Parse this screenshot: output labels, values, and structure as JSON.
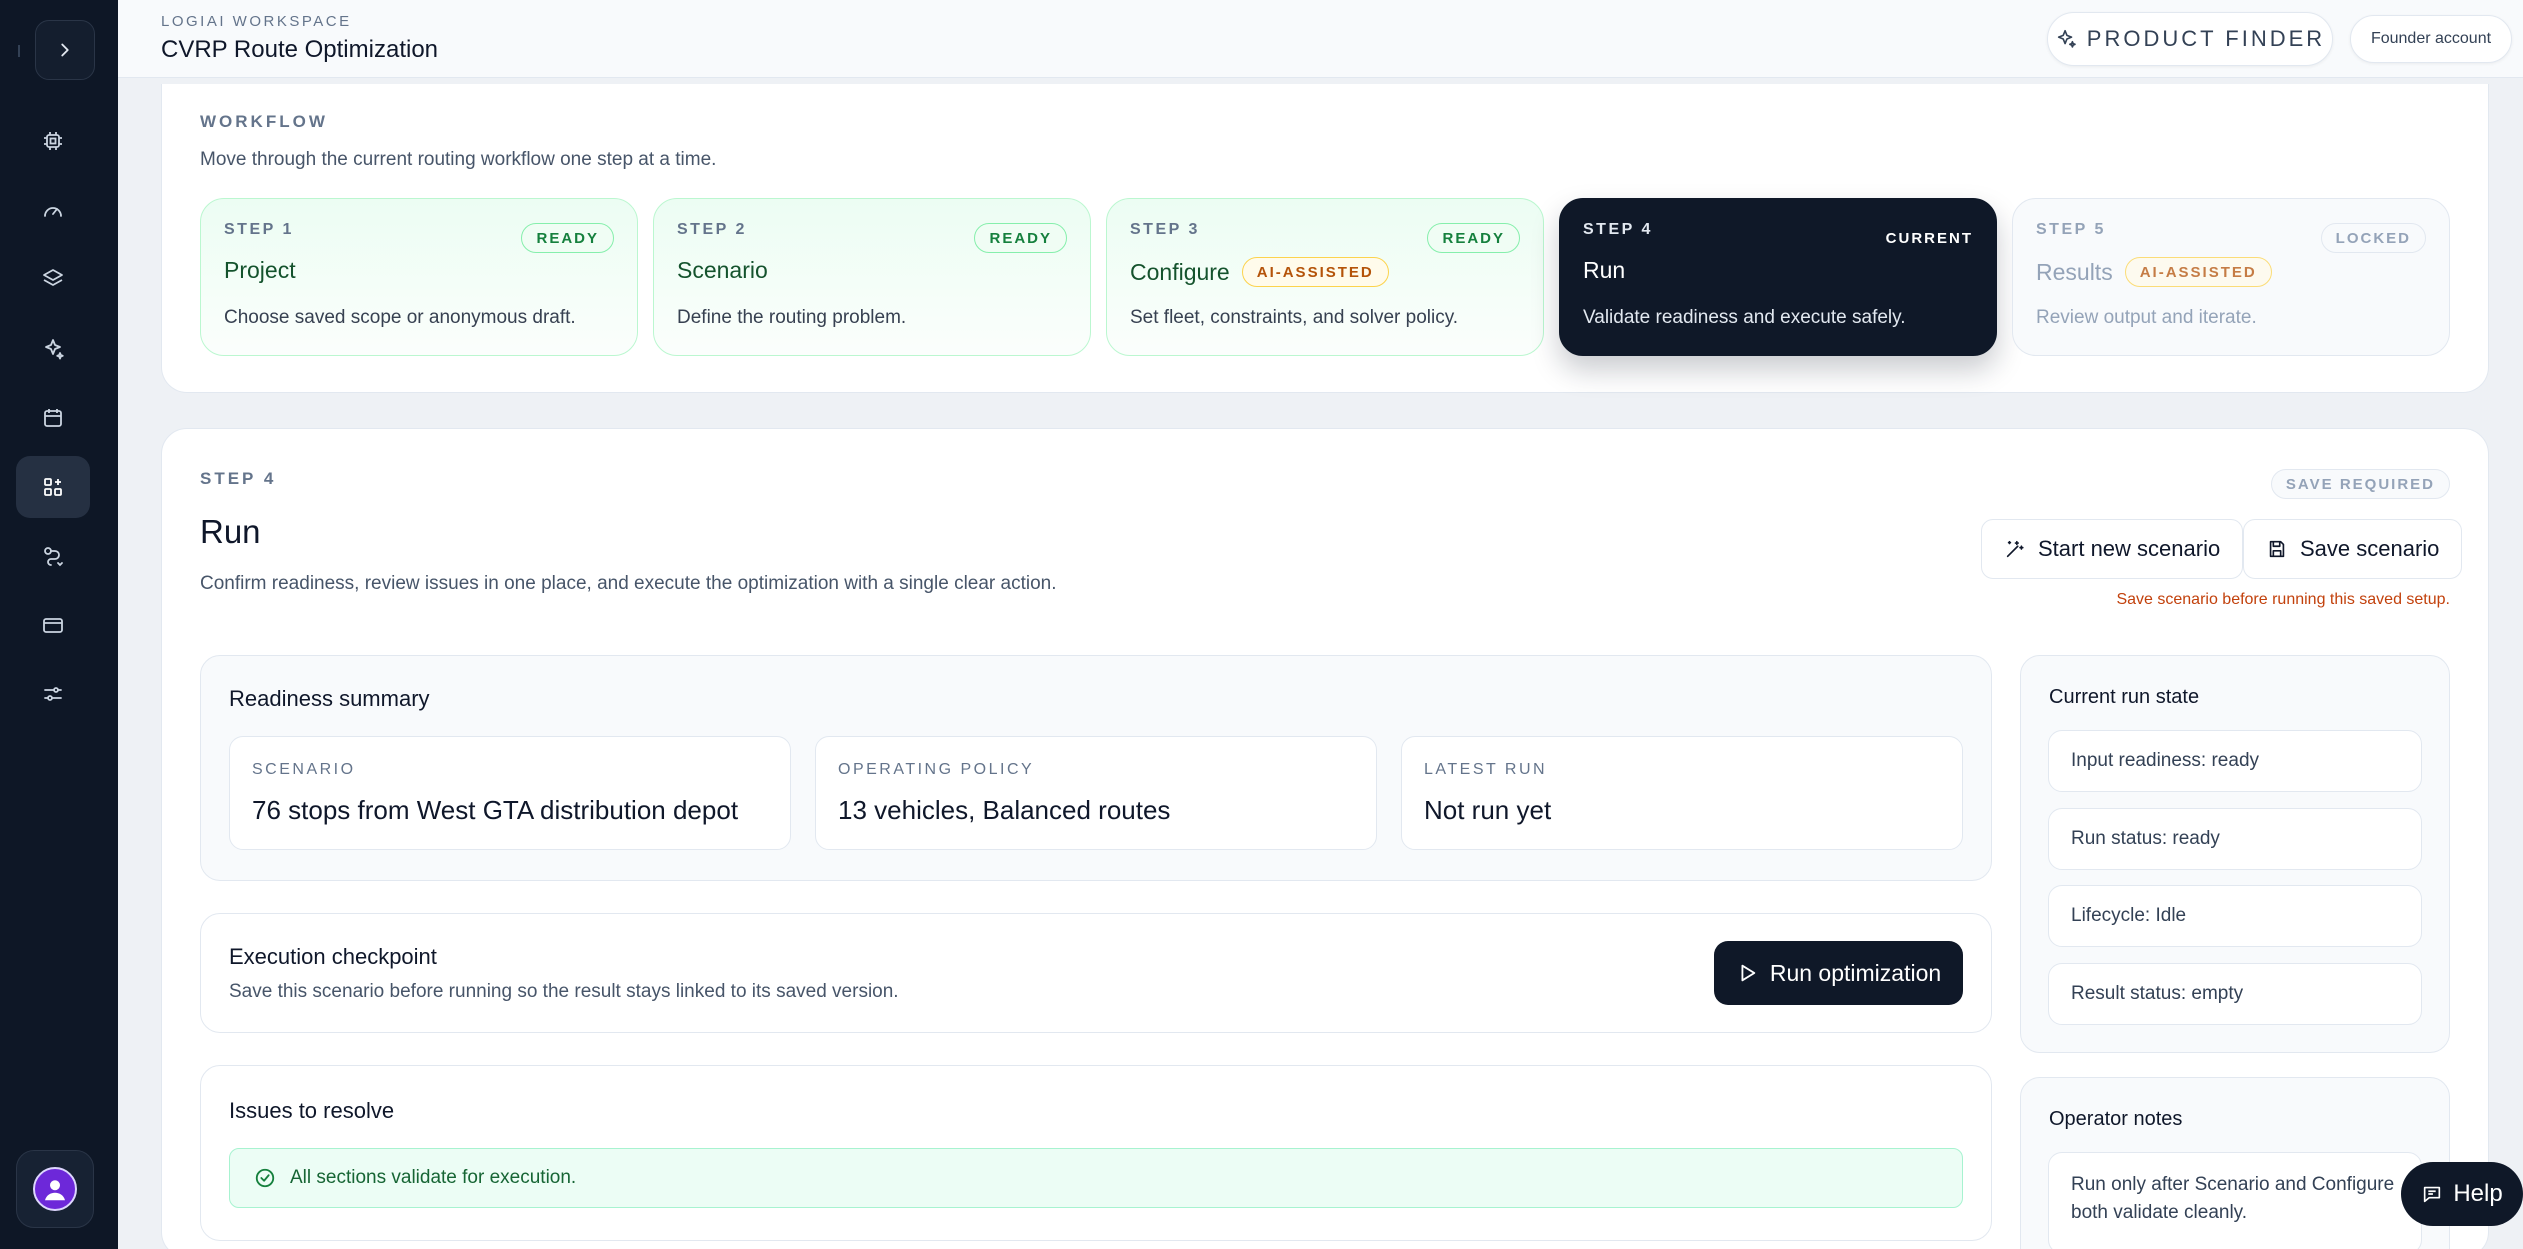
{
  "header": {
    "eyebrow": "LOGIAI WORKSPACE",
    "title": "CVRP Route Optimization",
    "product_finder_label": "PRODUCT FINDER",
    "account_label": "Founder account"
  },
  "sidebar": {
    "toggle_icon": "chevron-right-icon",
    "items": [
      {
        "icon": "cpu-icon",
        "active": false
      },
      {
        "icon": "gauge-icon",
        "active": false
      },
      {
        "icon": "layers-icon",
        "active": false
      },
      {
        "icon": "sparkles-icon",
        "active": false
      },
      {
        "icon": "calendar-icon",
        "active": false
      },
      {
        "icon": "grid-plus-icon",
        "active": true
      },
      {
        "icon": "route-icon",
        "active": false
      },
      {
        "icon": "credit-card-icon",
        "active": false
      },
      {
        "icon": "sliders-icon",
        "active": false
      }
    ],
    "avatar_icon": "user-avatar-icon"
  },
  "workflow": {
    "label": "WORKFLOW",
    "description": "Move through the current routing workflow one step at a time.",
    "steps": [
      {
        "num": "STEP 1",
        "name": "Project",
        "badge": "",
        "status": "READY",
        "desc": "Choose saved scope or anonymous draft."
      },
      {
        "num": "STEP 2",
        "name": "Scenario",
        "badge": "",
        "status": "READY",
        "desc": "Define the routing problem."
      },
      {
        "num": "STEP 3",
        "name": "Configure",
        "badge": "AI-ASSISTED",
        "status": "READY",
        "desc": "Set fleet, constraints, and solver policy."
      },
      {
        "num": "STEP 4",
        "name": "Run",
        "badge": "",
        "status": "CURRENT",
        "desc": "Validate readiness and execute safely."
      },
      {
        "num": "STEP 5",
        "name": "Results",
        "badge": "AI-ASSISTED",
        "status": "LOCKED",
        "desc": "Review output and iterate."
      }
    ]
  },
  "main": {
    "step_label": "STEP 4",
    "title": "Run",
    "subtitle": "Confirm readiness, review issues in one place, and execute the optimization with a single clear action.",
    "save_required": "SAVE REQUIRED",
    "start_new_label": "Start new scenario",
    "save_label": "Save scenario",
    "warning": "Save scenario before running this saved setup.",
    "readiness": {
      "title": "Readiness summary",
      "boxes": [
        {
          "key": "SCENARIO",
          "value": "76 stops from West GTA distribution depot"
        },
        {
          "key": "OPERATING POLICY",
          "value": "13 vehicles, Balanced routes"
        },
        {
          "key": "LATEST RUN",
          "value": "Not run yet"
        }
      ]
    },
    "checkpoint": {
      "title": "Execution checkpoint",
      "desc": "Save this scenario before running so the result stays linked to its saved version.",
      "run_label": "Run optimization"
    },
    "issues": {
      "title": "Issues to resolve",
      "ok": "All sections validate for execution."
    },
    "run_state": {
      "title": "Current run state",
      "items": [
        "Input readiness: ready",
        "Run status: ready",
        "Lifecycle: Idle",
        "Result status: empty"
      ]
    },
    "notes": {
      "title": "Operator notes",
      "text": "Run only after Scenario and Configure both validate cleanly."
    }
  },
  "help_label": "Help",
  "colors": {
    "sidebar_bg": "#0e1726",
    "accent_dark": "#0f1828",
    "ready_green": "#15803d",
    "ai_amber": "#b45309",
    "warning_orange": "#c2410c"
  }
}
